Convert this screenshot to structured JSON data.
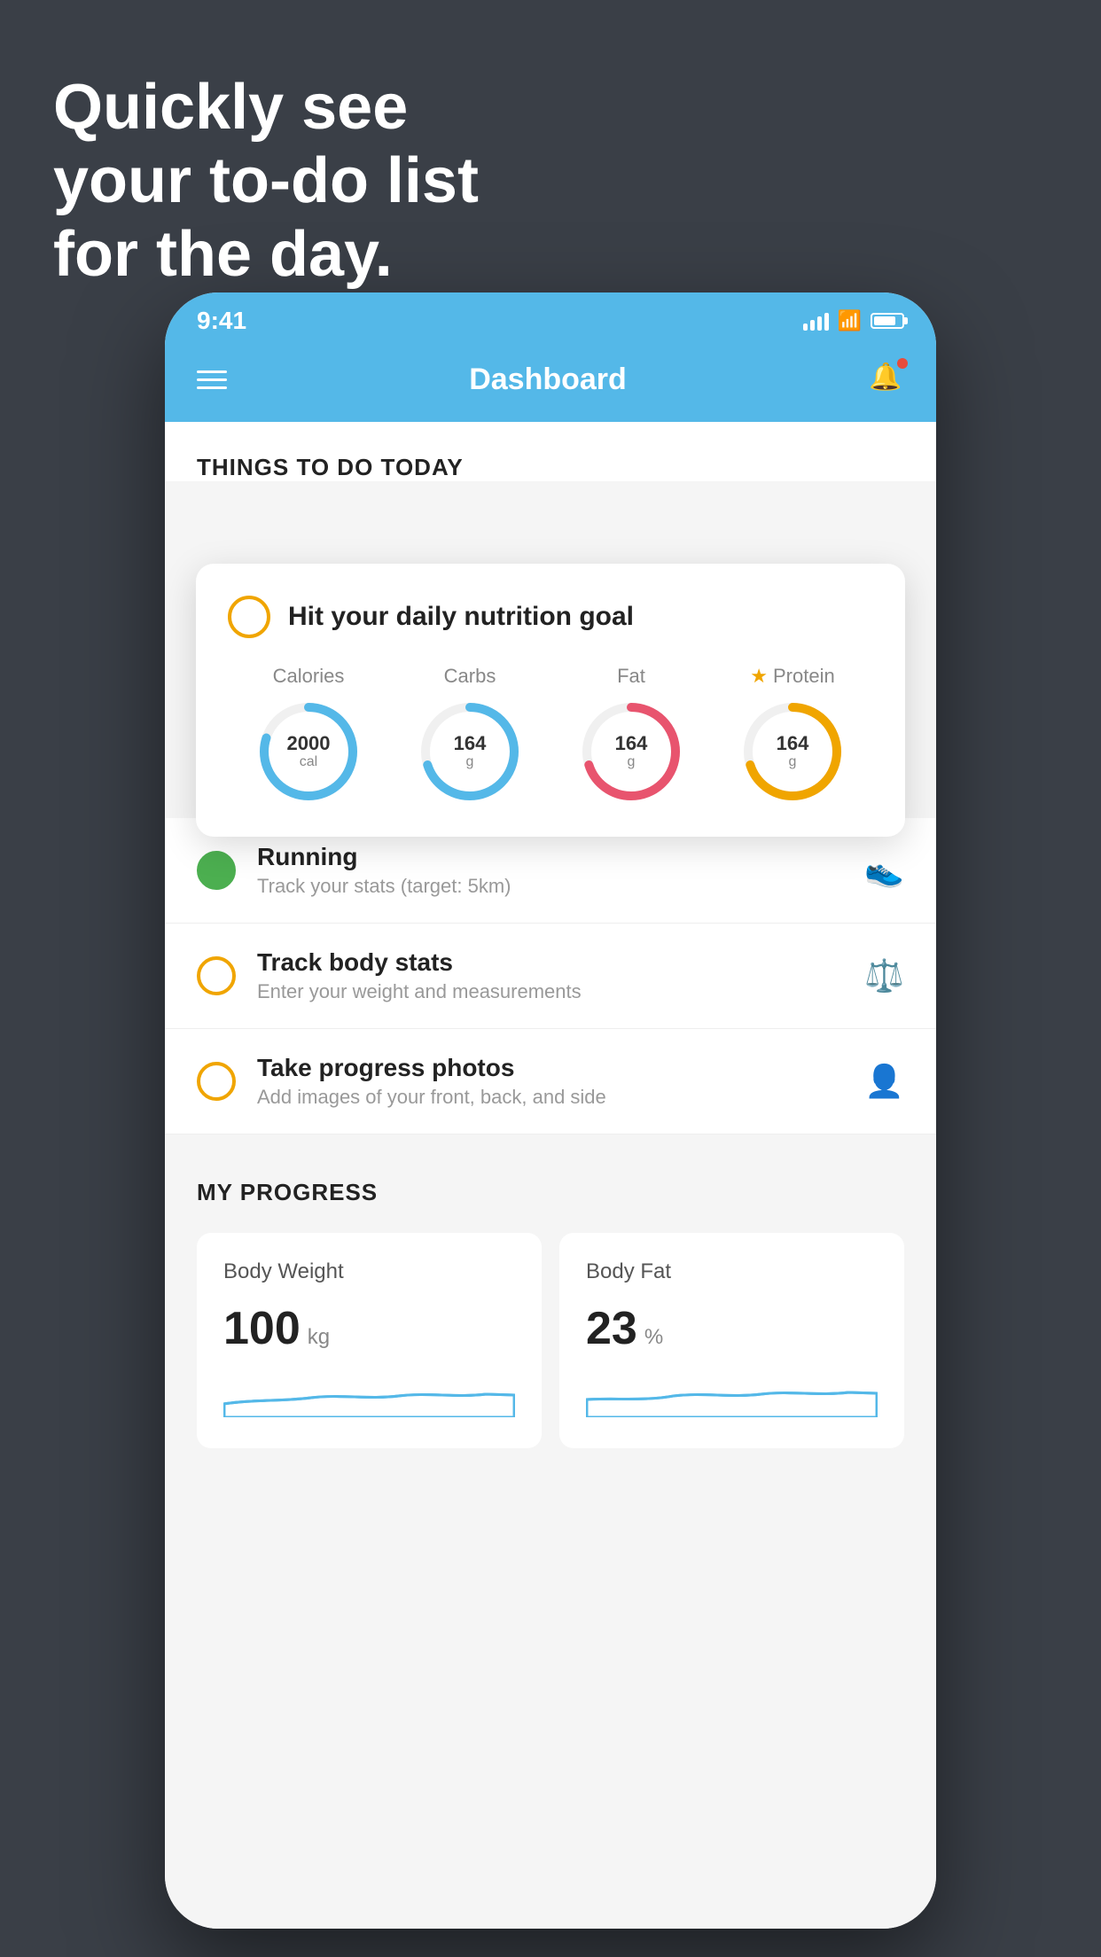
{
  "background": {
    "headline_line1": "Quickly see",
    "headline_line2": "your to-do list",
    "headline_line3": "for the day."
  },
  "status_bar": {
    "time": "9:41"
  },
  "header": {
    "title": "Dashboard"
  },
  "things_section": {
    "title": "THINGS TO DO TODAY"
  },
  "nutrition_card": {
    "checkbox_color": "#f0a500",
    "title": "Hit your daily nutrition goal",
    "metrics": [
      {
        "label": "Calories",
        "value": "2000",
        "unit": "cal",
        "color": "blue",
        "progress": 251
      },
      {
        "label": "Carbs",
        "value": "164",
        "unit": "g",
        "color": "blue",
        "progress": 220
      },
      {
        "label": "Fat",
        "value": "164",
        "unit": "g",
        "color": "pink",
        "progress": 220
      },
      {
        "label": "Protein",
        "value": "164",
        "unit": "g",
        "color": "gold",
        "progress": 220,
        "star": true
      }
    ]
  },
  "todo_items": [
    {
      "name": "Running",
      "desc": "Track your stats (target: 5km)",
      "circle": "green",
      "icon": "shoe"
    },
    {
      "name": "Track body stats",
      "desc": "Enter your weight and measurements",
      "circle": "yellow",
      "icon": "scale"
    },
    {
      "name": "Take progress photos",
      "desc": "Add images of your front, back, and side",
      "circle": "yellow",
      "icon": "person"
    }
  ],
  "progress_section": {
    "title": "MY PROGRESS",
    "cards": [
      {
        "title": "Body Weight",
        "value": "100",
        "unit": "kg"
      },
      {
        "title": "Body Fat",
        "value": "23",
        "unit": "%"
      }
    ]
  }
}
